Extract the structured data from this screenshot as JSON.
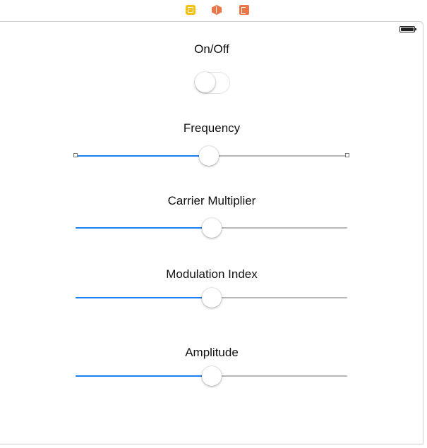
{
  "dock": {
    "icons": [
      "view-controller-icon",
      "first-responder-icon",
      "exit-icon"
    ]
  },
  "status_bar": {
    "battery_icon": "battery-icon"
  },
  "controls": {
    "onoff": {
      "label": "On/Off",
      "on": false
    },
    "frequency": {
      "label": "Frequency",
      "value": 0.49,
      "selected": true
    },
    "carrier_multiplier": {
      "label": "Carrier Multiplier",
      "value": 0.5
    },
    "modulation_index": {
      "label": "Modulation Index",
      "value": 0.5
    },
    "amplitude": {
      "label": "Amplitude",
      "value": 0.5
    }
  },
  "colors": {
    "accent": "#1a7ff0",
    "track": "#b7b7b7"
  }
}
